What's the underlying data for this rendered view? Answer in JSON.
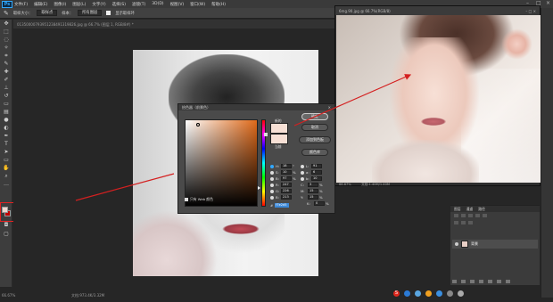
{
  "app": {
    "logo": "Ps",
    "menus": [
      "文件(F)",
      "编辑(E)",
      "图像(I)",
      "图层(L)",
      "文字(Y)",
      "选择(S)",
      "滤镜(T)",
      "3D(D)",
      "视图(V)",
      "窗口(W)",
      "帮助(H)"
    ],
    "window_controls": [
      "–",
      "□",
      "×"
    ]
  },
  "options_bar": {
    "sample_size_label": "取样大小：",
    "sample_size_value": "取样点",
    "sample_label": "样本：",
    "sample_value": "所有图层",
    "show_ring_label": "显示取样环"
  },
  "main_doc": {
    "tab_title": "01350000793951238491319826.jpg @ 66.7% (图层 1, RGB/8#) *",
    "zoom_status": "66.67%",
    "doc_status": "文档:973.4K/3.32M"
  },
  "photo_doc": {
    "tab_title": "6mg.90.jpg @ 66.7%(RGB/8)",
    "zoom_status": "66.67%",
    "doc_status": "文档:1.40M/1.40M"
  },
  "color_picker": {
    "title": "拾色器（前景色）",
    "new_label": "新的",
    "current_label": "当前",
    "buttons": {
      "ok": "确定",
      "cancel": "取消",
      "add_swatch": "添加到色板",
      "libraries": "颜色库"
    },
    "web_only_label": "只有 Web 颜色",
    "values": {
      "H": "18",
      "S": "10",
      "B": "97",
      "R": "247",
      "G": "226",
      "Bl": "213",
      "L": "91",
      "a": "6",
      "b": "10",
      "C": "3",
      "M": "15",
      "Y": "15",
      "K": "0"
    },
    "hex_label": "#",
    "hex_value": "f7e2d5"
  },
  "layers_panel": {
    "tabs": [
      "图层",
      "通道",
      "路径"
    ],
    "layer_name": "背景"
  },
  "colors": {
    "foreground": "#f0d8d0",
    "background": "#c00000",
    "annotation_red": "#d42020"
  }
}
